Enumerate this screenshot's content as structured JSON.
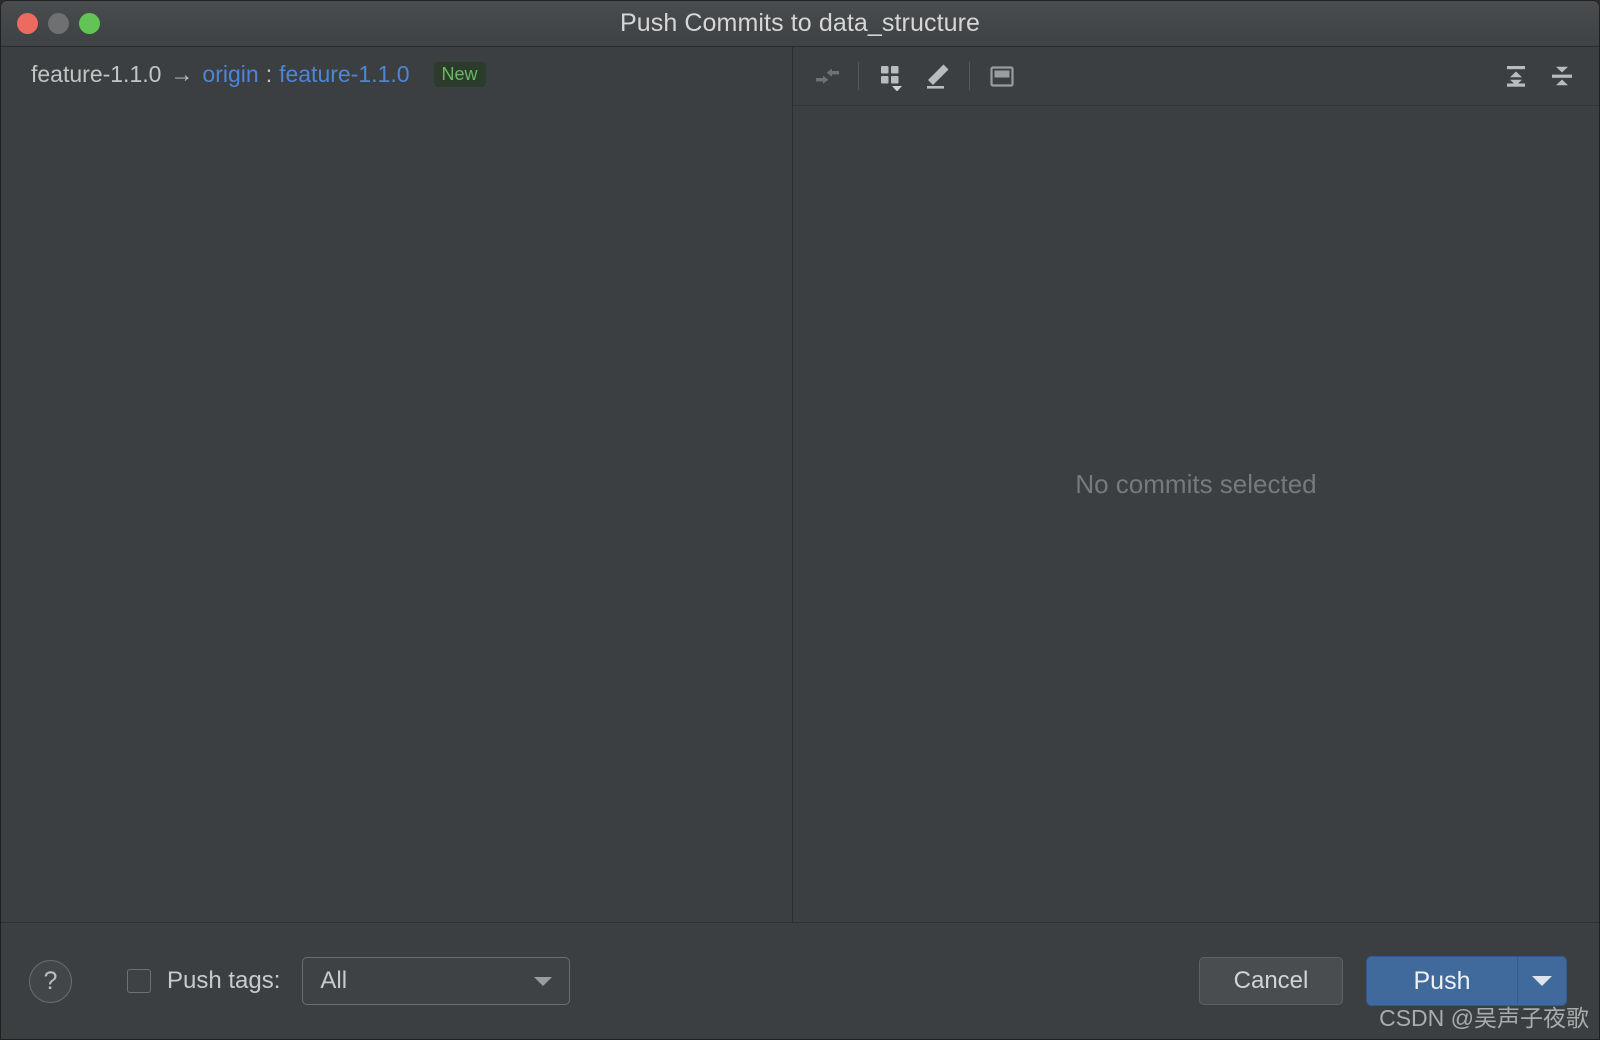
{
  "window": {
    "title": "Push Commits to data_structure",
    "traffic_lights": [
      {
        "name": "close",
        "color": "#ec6a5f"
      },
      {
        "name": "minimize",
        "color": "#6f7072"
      },
      {
        "name": "maximize",
        "color": "#62c454"
      }
    ]
  },
  "push_target": {
    "local_branch": "feature-1.1.0",
    "arrow": "→",
    "remote_name": "origin",
    "separator": ":",
    "remote_branch": "feature-1.1.0",
    "status_badge": "New",
    "badge_text_color": "#64b964",
    "badge_bg_color": "#2c3c2c",
    "remote_color": "#4d86d6"
  },
  "detail_toolbar": {
    "buttons": [
      {
        "name": "collapse-arrows-icon",
        "enabled": false
      },
      {
        "name": "grid-view-icon",
        "enabled": true
      },
      {
        "name": "edit-pencil-icon",
        "enabled": true
      },
      {
        "name": "preview-panel-icon",
        "enabled": true
      }
    ],
    "right_buttons": [
      {
        "name": "expand-all-icon",
        "enabled": true
      },
      {
        "name": "collapse-all-icon",
        "enabled": true
      }
    ]
  },
  "detail_panel": {
    "empty_message": "No commits selected"
  },
  "footer": {
    "help_label": "?",
    "push_tags_label": "Push tags:",
    "push_tags_checked": false,
    "push_tags_value": "All",
    "push_tags_options": [
      "All"
    ],
    "cancel_label": "Cancel",
    "push_label": "Push"
  },
  "watermark": {
    "text": "CSDN @吴声子夜歌"
  }
}
